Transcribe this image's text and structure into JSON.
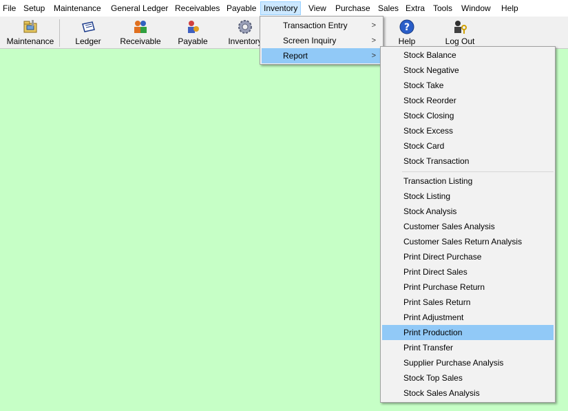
{
  "menubar": {
    "items": [
      "File",
      "Setup",
      "Maintenance",
      "General Ledger",
      "Receivables",
      "Payable",
      "Inventory",
      "View",
      "Purchase",
      "Sales",
      "Extra",
      "Tools",
      "Window",
      "Help"
    ]
  },
  "toolbar": {
    "maintenance": "Maintenance",
    "ledger": "Ledger",
    "receivable": "Receivable",
    "payable": "Payable",
    "inventory": "Inventory",
    "help": "Help",
    "logout": "Log Out"
  },
  "inventory_menu": {
    "items": [
      "Transaction Entry",
      "Screen Inquiry",
      "Report"
    ]
  },
  "report_menu": {
    "group1": [
      "Stock Balance",
      "Stock Negative",
      "Stock Take",
      "Stock Reorder",
      "Stock Closing",
      "Stock Excess",
      "Stock Card",
      "Stock Transaction"
    ],
    "group2": [
      "Transaction Listing",
      "Stock Listing",
      "Stock Analysis",
      "Customer Sales Analysis",
      "Customer Sales Return Analysis",
      "Print Direct Purchase",
      "Print Direct Sales",
      "Print Purchase Return",
      "Print Sales Return",
      "Print Adjustment",
      "Print Production",
      "Print Transfer",
      "Supplier Purchase Analysis",
      "Stock Top Sales",
      "Stock Sales Analysis"
    ]
  },
  "colors": {
    "desktop": "#c6ffc6",
    "highlight": "#91c9f7",
    "menubar_active": "#cce8ff"
  }
}
